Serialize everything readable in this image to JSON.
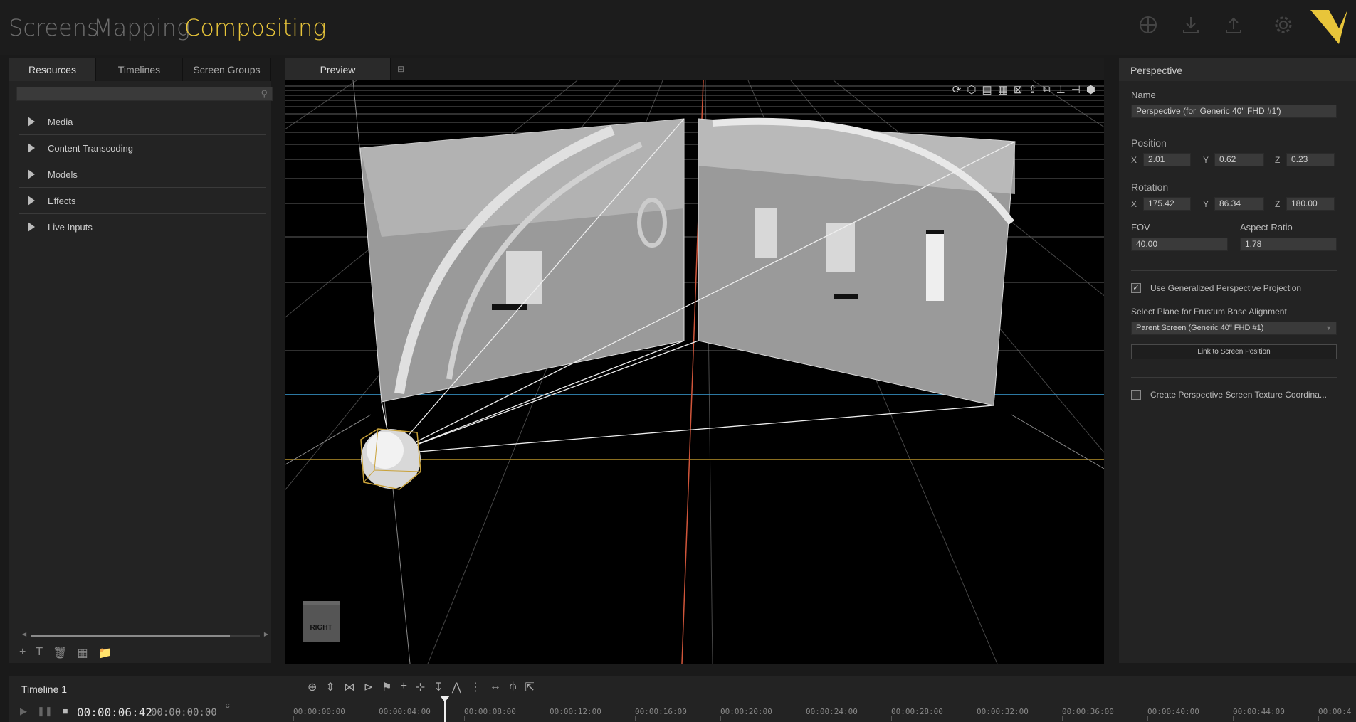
{
  "nav": {
    "tabs": [
      "Screens",
      "Mapping",
      "Compositing"
    ],
    "active": "Compositing",
    "icons": [
      "globe-icon",
      "download-icon",
      "upload-icon",
      "gear-icon"
    ],
    "accent_color": "#e8c53a"
  },
  "left_panel": {
    "tabs": [
      "Resources",
      "Timelines",
      "Screen Groups"
    ],
    "search_placeholder": "",
    "tree": [
      "Media",
      "Content Transcoding",
      "Models",
      "Effects",
      "Live Inputs"
    ],
    "tools": [
      "+",
      "T",
      "🗑",
      "▦",
      "📁"
    ]
  },
  "preview": {
    "tab_label": "Preview",
    "cube_label": "RIGHT"
  },
  "right_panel": {
    "title": "Perspective",
    "name_label": "Name",
    "name_value": "Perspective (for 'Generic 40\" FHD #1')",
    "position_label": "Position",
    "position": {
      "x": "2.01",
      "y": "0.62",
      "z": "0.23"
    },
    "rotation_label": "Rotation",
    "rotation": {
      "x": "175.42",
      "y": "86.34",
      "z": "180.00"
    },
    "axis": {
      "x": "X",
      "y": "Y",
      "z": "Z"
    },
    "fov_label": "FOV",
    "fov_value": "40.00",
    "aspect_label": "Aspect Ratio",
    "aspect_value": "1.78",
    "use_generalized_label": "Use Generalized Perspective Projection",
    "use_generalized_checked": true,
    "select_plane_label": "Select Plane for Frustum Base Alignment",
    "select_plane_value": "Parent Screen (Generic 40\" FHD #1)",
    "link_button": "Link to Screen Position",
    "create_texture_label": "Create Perspective Screen Texture Coordina...",
    "create_texture_checked": false
  },
  "timeline": {
    "name": "Timeline 1",
    "current_time": "00:00:06:42",
    "secondary_time": "00:00:00:00",
    "tc_label": "TC",
    "ticks": [
      "00:00:00:00",
      "00:00:04:00",
      "00:00:08:00",
      "00:00:12:00",
      "00:00:16:00",
      "00:00:20:00",
      "00:00:24:00",
      "00:00:28:00",
      "00:00:32:00",
      "00:00:36:00",
      "00:00:40:00",
      "00:00:44:00",
      "00:00:4"
    ]
  }
}
